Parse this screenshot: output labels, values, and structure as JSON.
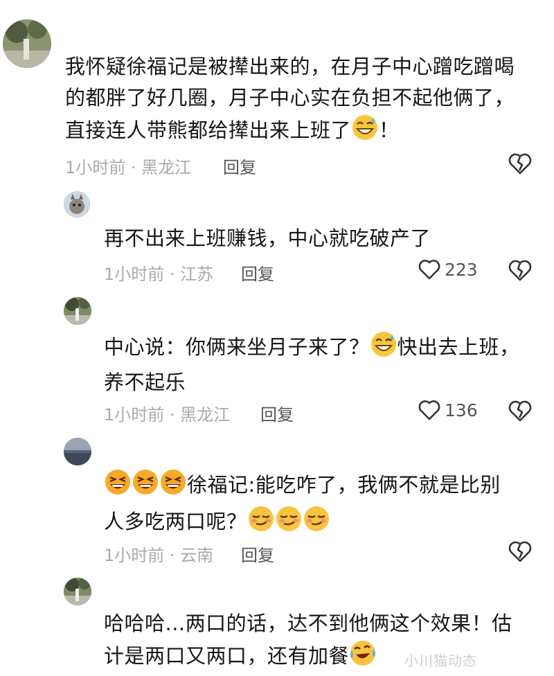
{
  "comments": [
    {
      "line1": "我怀疑徐福记是被撵出来的，在月子中心蹭吃蹭喝",
      "line2": "的都胖了好几圈，月子中心实在负担不起他俩了，",
      "line3": "直接连人带熊都给撵出来上班了",
      "line3_end": "！",
      "meta": "1小时前 · 黑龙江",
      "reply": "回复"
    },
    {
      "line1": "再不出来上班赚钱，中心就吃破产了",
      "meta": "1小时前 · 江苏",
      "reply": "回复",
      "likes": "223"
    },
    {
      "line1a": "中心说：你俩来坐月子来了？",
      "line1b": "快出去上班，",
      "line2": "养不起乐",
      "meta": "1小时前 · 黑龙江",
      "reply": "回复",
      "likes": "136"
    },
    {
      "line1": "徐福记:能吃咋了，我俩不就是比别",
      "line2": "人多吃两口呢？",
      "meta": "1小时前 · 云南",
      "reply": "回复"
    },
    {
      "line1": "哈哈哈...两口的话，达不到他俩这个效果！估",
      "line2": "计是两口又两口，还有加餐"
    }
  ],
  "watermark": "小川猫动态",
  "icons": {
    "heart": "heart-outline-icon",
    "dislike": "broken-heart-icon",
    "emoji_sweat": "grinning-sweat-emoji",
    "emoji_laugh": "laughing-emoji",
    "emoji_smirk": "smirk-emoji",
    "emoji_cry_laugh": "tears-of-joy-emoji"
  }
}
